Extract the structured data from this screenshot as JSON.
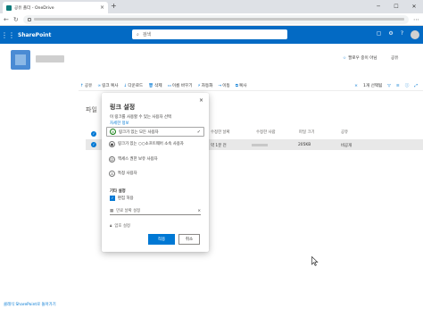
{
  "browser": {
    "tab_title": "공유 폴더 - OneDrive",
    "tab_close": "×",
    "new_tab": "+"
  },
  "suitebar": {
    "brand": "SharePoint",
    "search_placeholder": "검색",
    "help": "?"
  },
  "site": {
    "follow_star": "☆",
    "follow_label": "팔로우 중이 아님",
    "share_label": "공유"
  },
  "commandbar": {
    "items": [
      {
        "icon": "↑",
        "label": "공유"
      },
      {
        "icon": "∞",
        "label": "링크 복사"
      },
      {
        "icon": "↓",
        "label": "다운로드"
      },
      {
        "icon": "🗑",
        "label": "삭제"
      },
      {
        "icon": "▭",
        "label": "이름 바꾸기"
      },
      {
        "icon": "⚡",
        "label": "자동화"
      },
      {
        "icon": "→",
        "label": "이동"
      },
      {
        "icon": "⧉",
        "label": "복사"
      }
    ],
    "selected": "1개 선택됨",
    "close": "×"
  },
  "list": {
    "title": "파일",
    "columns": [
      "수정한 날짜",
      "수정한 사람",
      "파일 크기",
      "공유"
    ],
    "rows": [
      {
        "modified": "약 1분 전",
        "modified_by": "",
        "size": "205KB",
        "sharing": "비공개"
      }
    ]
  },
  "dialog": {
    "close": "×",
    "title": "링크 설정",
    "subtitle": "이 링크를 사용할 수 있는 사용자 선택",
    "learn_more": "자세한 정보",
    "options": [
      {
        "label": "링크가 있는 모든 사용자",
        "selected": true
      },
      {
        "label": "링크가 있는 ○○소프트웨어 소속 사용자",
        "selected": false
      },
      {
        "label": "액세스 권한 보유 사용자",
        "selected": false
      },
      {
        "label": "특정 사용자",
        "selected": false
      }
    ],
    "other_settings": "기타 설정",
    "allow_edit": "편집 허용",
    "expiry_placeholder": "만료 날짜 설정",
    "password_placeholder": "암호 설정",
    "apply": "적용",
    "cancel": "취소"
  },
  "leftnav": {
    "return_link": "클래식 SharePoint로 돌아가기"
  }
}
